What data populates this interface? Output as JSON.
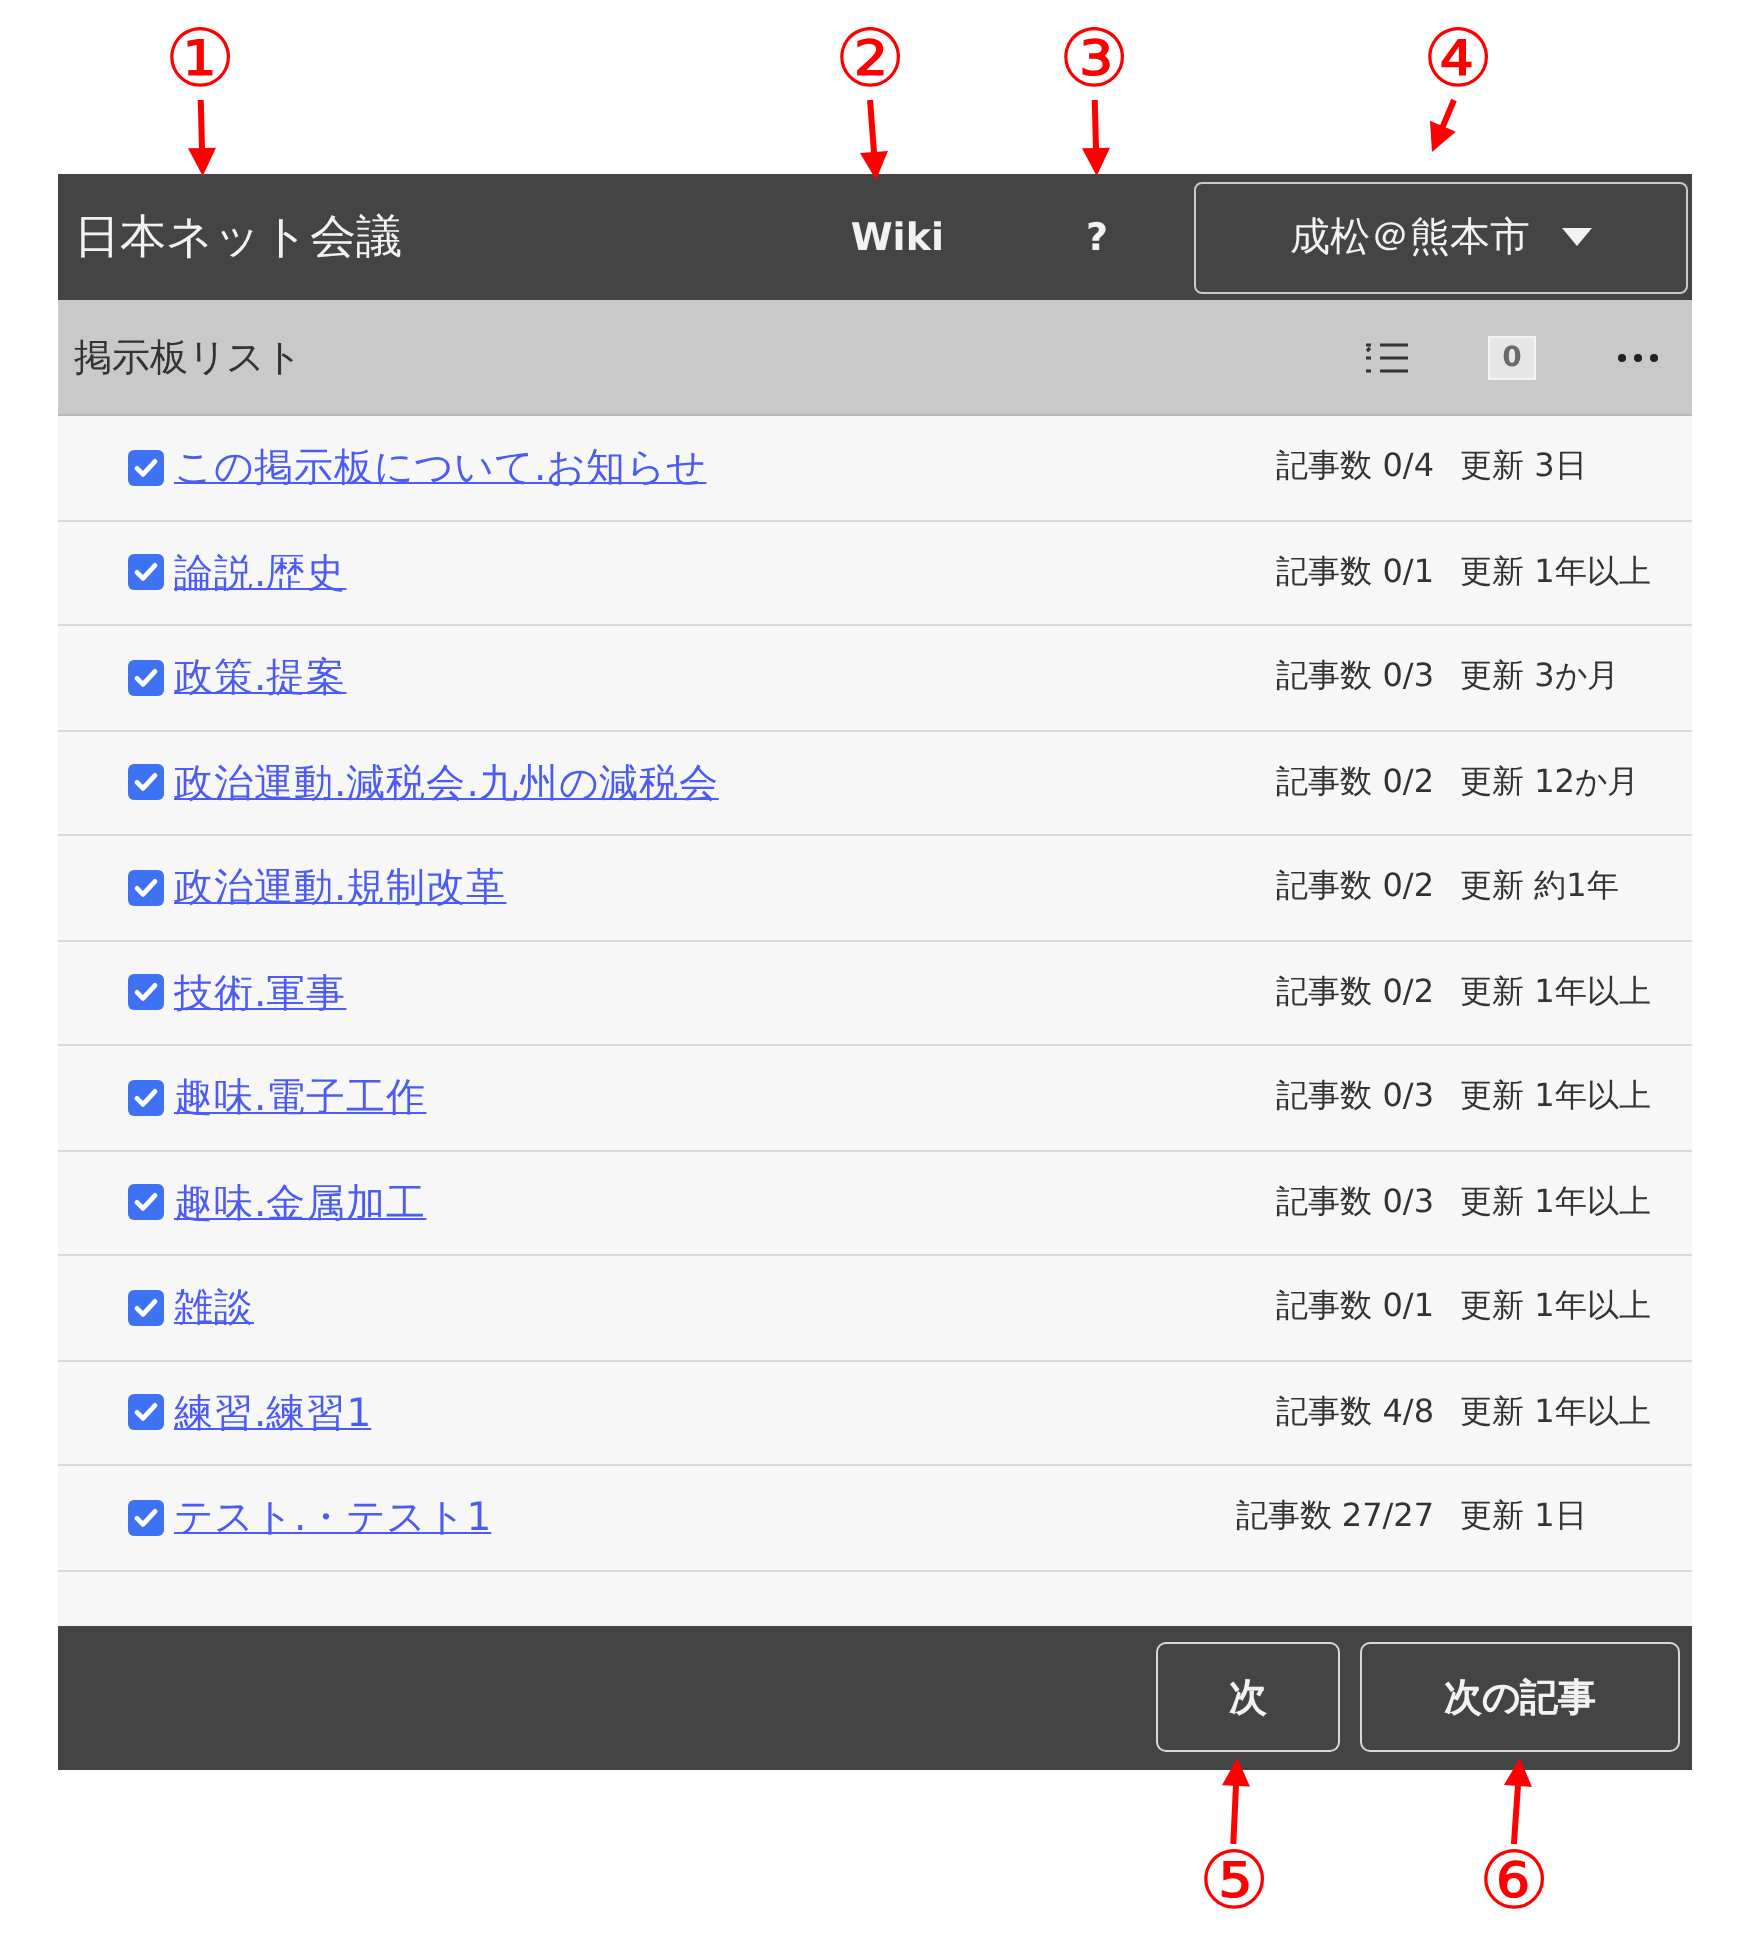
{
  "callouts_top": [
    "①",
    "②",
    "③",
    "④"
  ],
  "header": {
    "title": "日本ネット会議",
    "links": [
      "Wiki",
      "?"
    ],
    "user_menu": "成松＠熊本市"
  },
  "toolbar": {
    "title": "掲示板リスト",
    "count_badge": "0"
  },
  "boards": [
    {
      "title": "この掲示板について.お知らせ",
      "checked": true,
      "posts": "記事数 0/4",
      "updated": "更新 3日"
    },
    {
      "title": "論説.歴史",
      "checked": true,
      "posts": "記事数 0/1",
      "updated": "更新 1年以上"
    },
    {
      "title": "政策.提案",
      "checked": true,
      "posts": "記事数 0/3",
      "updated": "更新 3か月"
    },
    {
      "title": "政治運動.減税会.九州の減税会",
      "checked": true,
      "posts": "記事数 0/2",
      "updated": "更新 12か月"
    },
    {
      "title": "政治運動.規制改革",
      "checked": true,
      "posts": "記事数 0/2",
      "updated": "更新 約1年"
    },
    {
      "title": "技術.軍事",
      "checked": true,
      "posts": "記事数 0/2",
      "updated": "更新 1年以上"
    },
    {
      "title": "趣味.電子工作",
      "checked": true,
      "posts": "記事数 0/3",
      "updated": "更新 1年以上"
    },
    {
      "title": "趣味.金属加工",
      "checked": true,
      "posts": "記事数 0/3",
      "updated": "更新 1年以上"
    },
    {
      "title": "雑談",
      "checked": true,
      "posts": "記事数 0/1",
      "updated": "更新 1年以上"
    },
    {
      "title": "練習.練習1",
      "checked": true,
      "posts": "記事数 4/8",
      "updated": "更新 1年以上"
    },
    {
      "title": "テスト.・テスト1",
      "checked": true,
      "posts": "記事数 27/27",
      "updated": "更新 1日"
    }
  ],
  "footer": {
    "buttons": [
      "次",
      "次の記事"
    ]
  },
  "callouts_bottom": [
    "⑤",
    "⑥"
  ]
}
